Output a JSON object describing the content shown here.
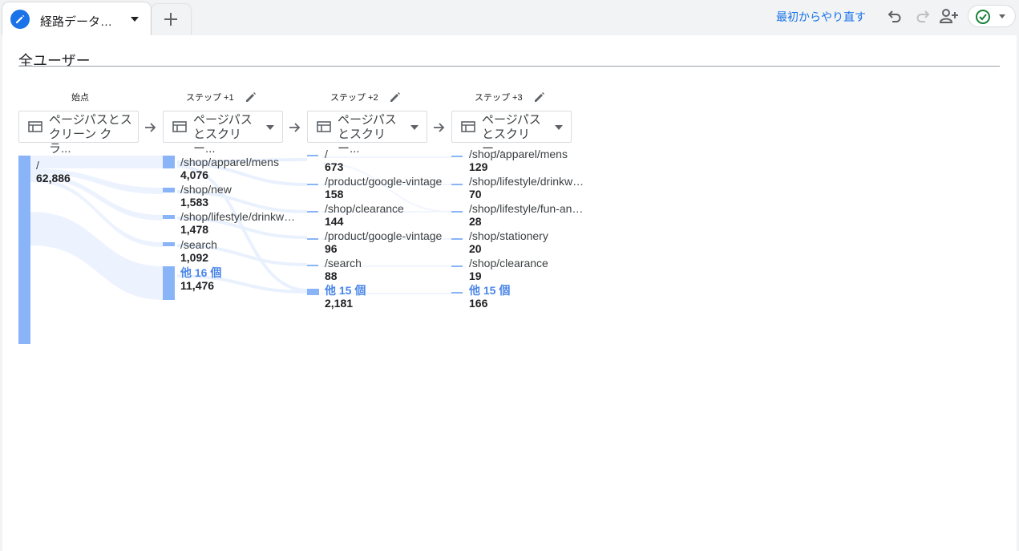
{
  "tab": {
    "label": "経路データ探索"
  },
  "toolbar": {
    "reset_label": "最初からやり直す"
  },
  "colors": {
    "accent": "#1a73e8",
    "node": "#8ab4f8",
    "flow": "#e8f0fe",
    "more_text": "#4a86e8"
  },
  "segment": {
    "title": "全ユーザー"
  },
  "steps": [
    {
      "label": "始点",
      "dropdown": "ページパスとス\nクリーン クラ..."
    },
    {
      "label": "ステップ +1",
      "dropdown": "ページパス\nとスクリー..."
    },
    {
      "label": "ステップ +2",
      "dropdown": "ページパス\nとスクリー..."
    },
    {
      "label": "ステップ +3",
      "dropdown": "ページパス\nとスクリー..."
    }
  ],
  "columns": [
    {
      "nodes": [
        {
          "label": "/",
          "value": "62,886"
        }
      ]
    },
    {
      "nodes": [
        {
          "label": "/shop/apparel/mens",
          "value": "4,076"
        },
        {
          "label": "/shop/new",
          "value": "1,583"
        },
        {
          "label": "/shop/lifestyle/drinkware",
          "value": "1,478"
        },
        {
          "label": "/search",
          "value": "1,092"
        },
        {
          "label": "他 16 個",
          "value": "11,476",
          "more": true
        }
      ]
    },
    {
      "nodes": [
        {
          "label": "/",
          "value": "673"
        },
        {
          "label": "/product/google-vintage",
          "value": "158"
        },
        {
          "label": "/shop/clearance",
          "value": "144"
        },
        {
          "label": "/product/google-vintage",
          "value": "96"
        },
        {
          "label": "/search",
          "value": "88"
        },
        {
          "label": "他 15 個",
          "value": "2,181",
          "more": true
        }
      ]
    },
    {
      "nodes": [
        {
          "label": "/shop/apparel/mens",
          "value": "129"
        },
        {
          "label": "/shop/lifestyle/drinkware",
          "value": "70"
        },
        {
          "label": "/shop/lifestyle/fun-and-games",
          "value": "28"
        },
        {
          "label": "/shop/stationery",
          "value": "20"
        },
        {
          "label": "/shop/clearance",
          "value": "19"
        },
        {
          "label": "他 15 個",
          "value": "166",
          "more": true
        }
      ]
    }
  ]
}
